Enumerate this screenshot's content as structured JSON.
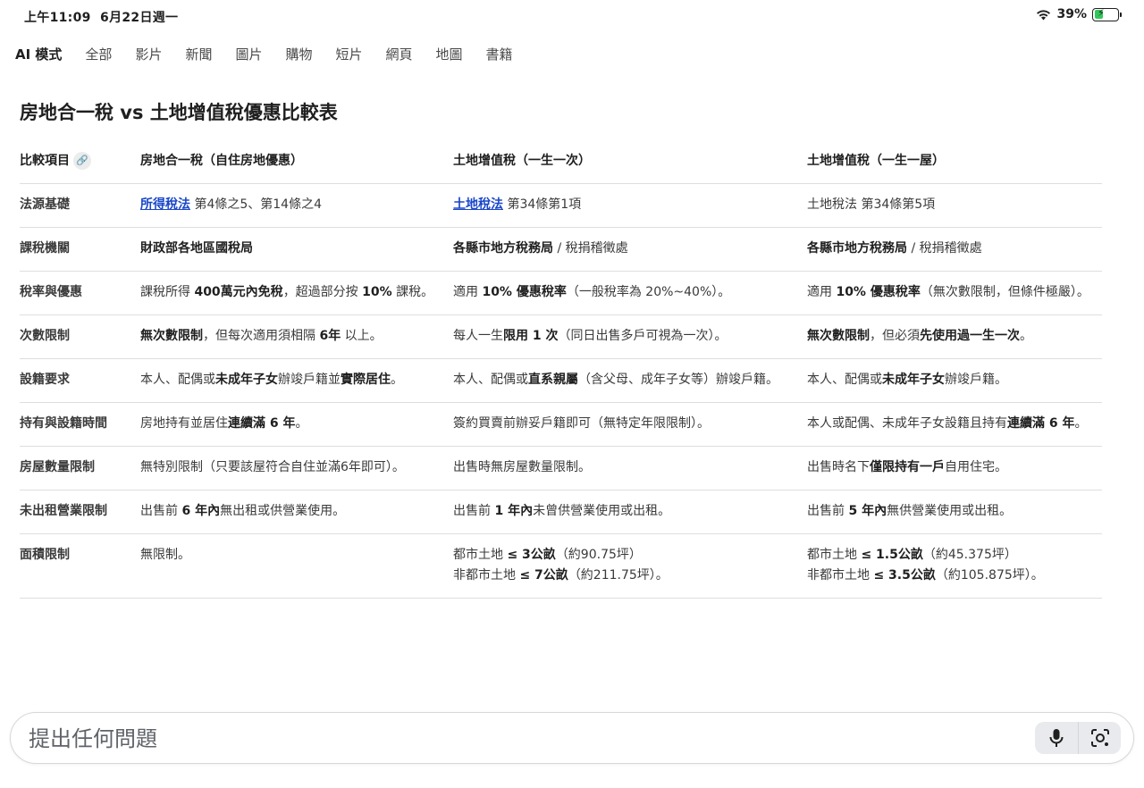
{
  "status": {
    "time": "上午11:09",
    "date": "6月22日週一",
    "battery": "39%"
  },
  "tabs": [
    "AI 模式",
    "全部",
    "影片",
    "新聞",
    "圖片",
    "購物",
    "短片",
    "網頁",
    "地圖",
    "書籍"
  ],
  "title": "房地合一稅 vs 土地增值稅優惠比較表",
  "table": {
    "headers": [
      "比較項目",
      "房地合一稅（自住房地優惠）",
      "土地增值稅（一生一次）",
      "土地增值稅（一生一屋）"
    ],
    "rows": [
      {
        "label": "法源基礎",
        "c1": [
          "<a class='law-link' data-name='law-link' data-interactable='true'>所得稅法</a> 第4條之5、第14條之4"
        ],
        "c2": [
          "<a class='law-link' data-name='law-link' data-interactable='true'>土地稅法</a> 第34條第1項"
        ],
        "c3": [
          "土地稅法 第34條第5項"
        ]
      },
      {
        "label": "課稅機關",
        "c1": [
          "<b>財政部各地區國稅局</b>"
        ],
        "c2": [
          "<b>各縣市地方稅務局</b> / 稅捐稽徵處"
        ],
        "c3": [
          "<b>各縣市地方稅務局</b> / 稅捐稽徵處"
        ]
      },
      {
        "label": "稅率與優惠",
        "c1": [
          "課稅所得 <b>400萬元內免稅</b>，超過部分按 <b>10%</b> 課稅。"
        ],
        "c2": [
          "適用 <b>10% 優惠稅率</b>（一般稅率為 20%~40%）。"
        ],
        "c3": [
          "適用 <b>10% 優惠稅率</b>（無次數限制，但條件極嚴）。"
        ]
      },
      {
        "label": "次數限制",
        "c1": [
          "<b>無次數限制</b>，但每次適用須相隔 <b>6年</b> 以上。"
        ],
        "c2": [
          "每人一生<b>限用 1 次</b>（同日出售多戶可視為一次）。"
        ],
        "c3": [
          "<b>無次數限制</b>，但必須<b>先使用過一生一次</b>。"
        ]
      },
      {
        "label": "設籍要求",
        "c1": [
          "本人、配偶或<b>未成年子女</b>辦竣戶籍並<b>實際居住</b>。"
        ],
        "c2": [
          "本人、配偶或<b>直系親屬</b>（含父母、成年子女等）辦竣戶籍。"
        ],
        "c3": [
          "本人、配偶或<b>未成年子女</b>辦竣戶籍。"
        ]
      },
      {
        "label": "持有與設籍時間",
        "c1": [
          "房地持有並居住<b>連續滿 6 年</b>。"
        ],
        "c2": [
          "簽約買賣前辦妥戶籍即可（無特定年限限制）。"
        ],
        "c3": [
          "本人或配偶、未成年子女設籍且持有<b>連續滿 6 年</b>。"
        ]
      },
      {
        "label": "房屋數量限制",
        "c1": [
          "無特別限制（只要該屋符合自住並滿6年即可）。"
        ],
        "c2": [
          "出售時無房屋數量限制。"
        ],
        "c3": [
          "出售時名下<b>僅限持有一戶</b>自用住宅。"
        ]
      },
      {
        "label": "未出租營業限制",
        "c1": [
          "出售前 <b>6 年內</b>無出租或供營業使用。"
        ],
        "c2": [
          "出售前 <b>1 年內</b>未曾供營業使用或出租。"
        ],
        "c3": [
          "出售前 <b>5 年內</b>無供營業使用或出租。"
        ]
      },
      {
        "label": "面積限制",
        "c1": [
          "無限制。"
        ],
        "c2": [
          "都市土地 <b>≤ 3公畝</b>（約90.75坪）",
          "非都市土地 <b>≤ 7公畝</b>（約211.75坪）。"
        ],
        "c3": [
          "都市土地 <b>≤ 1.5公畝</b>（約45.375坪）",
          "非都市土地 <b>≤ 3.5公畝</b>（約105.875坪）。"
        ]
      }
    ]
  },
  "ask": {
    "placeholder": "提出任何問題"
  },
  "icons": {
    "wifi": "wifi-icon",
    "battery": "battery-icon",
    "link": "link-icon",
    "mic": "mic-icon",
    "lens": "camera-search-icon"
  }
}
